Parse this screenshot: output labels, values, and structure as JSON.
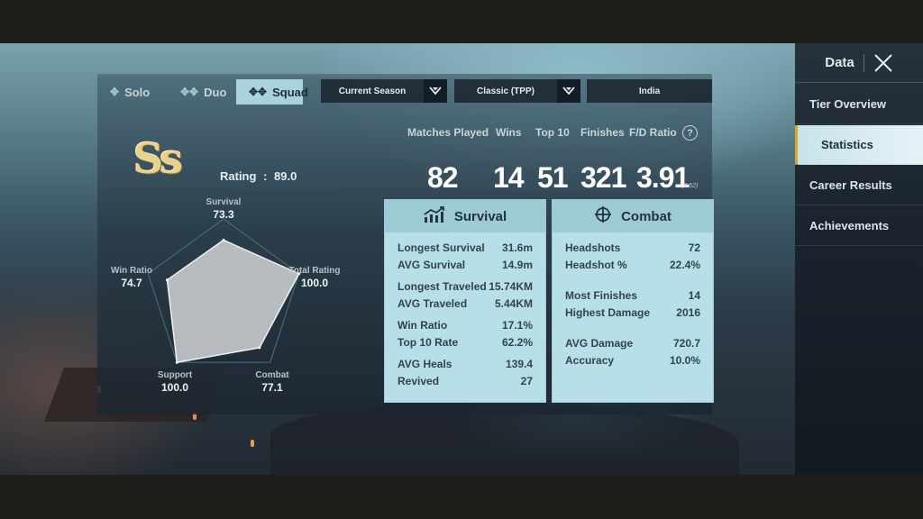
{
  "mode_tabs": [
    {
      "label": "Solo",
      "icon": "solo-player-icon",
      "active": false
    },
    {
      "label": "Duo",
      "icon": "duo-players-icon",
      "active": false
    },
    {
      "label": "Squad",
      "icon": "squad-players-icon",
      "active": true
    }
  ],
  "filters": {
    "season": "Current Season",
    "mode": "Classic (TPP)",
    "region": "India"
  },
  "tier": {
    "badge": "Ss",
    "rating_label": "Rating",
    "rating_sep": ":",
    "rating_value": "89.0"
  },
  "radar": {
    "axes": [
      {
        "label": "Survival",
        "value": "73.3"
      },
      {
        "label": "Total Rating",
        "value": "100.0"
      },
      {
        "label": "Combat",
        "value": "77.1"
      },
      {
        "label": "Support",
        "value": "100.0"
      },
      {
        "label": "Win Ratio",
        "value": "74.7"
      }
    ]
  },
  "summary": {
    "headers": [
      "Matches Played",
      "Wins",
      "Top 10",
      "Finishes",
      "F/D Ratio"
    ],
    "values": [
      "82",
      "14",
      "51",
      "321",
      "3.91"
    ],
    "fd_sub": "(4.52)",
    "help_icon": "question-circle-icon"
  },
  "survival_card": {
    "title": "Survival",
    "icon": "bar-chart-trend-icon",
    "groups": [
      [
        {
          "label": "Longest Survival",
          "value": "31.6m"
        },
        {
          "label": "AVG Survival",
          "value": "14.9m"
        }
      ],
      [
        {
          "label": "Longest Traveled",
          "value": "15.74KM"
        },
        {
          "label": "AVG Traveled",
          "value": "5.44KM"
        }
      ],
      [
        {
          "label": "Win Ratio",
          "value": "17.1%"
        },
        {
          "label": "Top 10 Rate",
          "value": "62.2%"
        }
      ],
      [
        {
          "label": "AVG Heals",
          "value": "139.4"
        },
        {
          "label": "Revived",
          "value": "27"
        }
      ]
    ]
  },
  "combat_card": {
    "title": "Combat",
    "icon": "crosshair-icon",
    "groups": [
      [
        {
          "label": "Headshots",
          "value": "72"
        },
        {
          "label": "Headshot %",
          "value": "22.4%"
        }
      ],
      [
        {
          "label": "Most Finishes",
          "value": "14"
        },
        {
          "label": "Highest Damage",
          "value": "2016"
        }
      ],
      [
        {
          "label": "AVG Damage",
          "value": "720.7"
        },
        {
          "label": "Accuracy",
          "value": "10.0%"
        }
      ]
    ]
  },
  "sidebar": {
    "title": "Data",
    "items": [
      {
        "label": "Tier Overview",
        "active": false
      },
      {
        "label": "Statistics",
        "active": true
      },
      {
        "label": "Career Results",
        "active": false
      },
      {
        "label": "Achievements",
        "active": false
      }
    ]
  },
  "colors": {
    "accent_gold": "#d9a92a",
    "card_bg": "#b7dfe7",
    "active_tab": "#a8d3de"
  }
}
